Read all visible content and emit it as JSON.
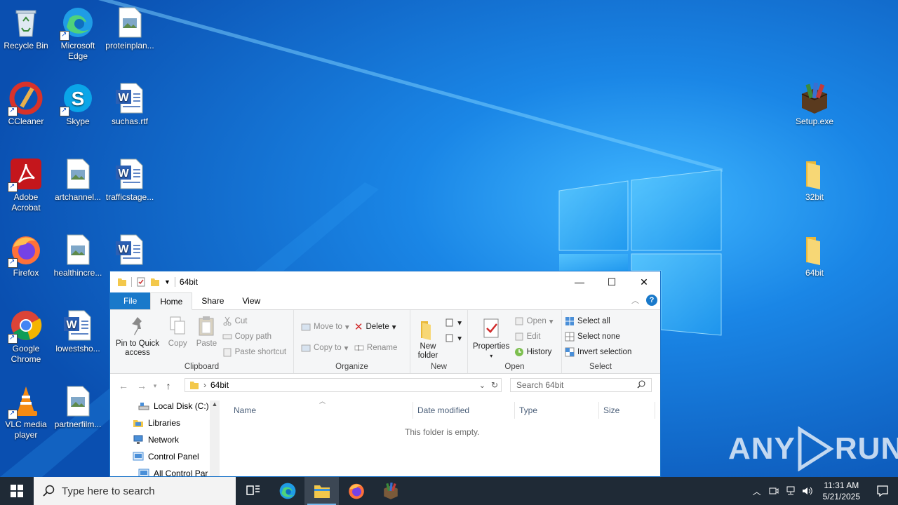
{
  "desktop": {
    "icons": [
      {
        "label": "Recycle Bin"
      },
      {
        "label": "Microsoft Edge"
      },
      {
        "label": "proteinplan..."
      },
      {
        "label": "CCleaner"
      },
      {
        "label": "Skype"
      },
      {
        "label": "suchas.rtf"
      },
      {
        "label": "Adobe Acrobat"
      },
      {
        "label": "artchannel..."
      },
      {
        "label": "trafficstage..."
      },
      {
        "label": "Firefox"
      },
      {
        "label": "healthincre..."
      },
      {
        "label": ""
      },
      {
        "label": "Google Chrome"
      },
      {
        "label": "lowestsho..."
      },
      {
        "label": "VLC media player"
      },
      {
        "label": "partnerfilm..."
      },
      {
        "label": "Setup.exe"
      },
      {
        "label": "32bit"
      },
      {
        "label": "64bit"
      }
    ]
  },
  "explorer": {
    "title": "64bit",
    "tabs": {
      "file": "File",
      "home": "Home",
      "share": "Share",
      "view": "View"
    },
    "ribbon": {
      "clipboard": {
        "label": "Clipboard",
        "pin": "Pin to Quick access",
        "copy": "Copy",
        "paste": "Paste",
        "cut": "Cut",
        "copy_path": "Copy path",
        "paste_shortcut": "Paste shortcut"
      },
      "organize": {
        "label": "Organize",
        "move_to": "Move to",
        "copy_to": "Copy to",
        "delete": "Delete",
        "rename": "Rename"
      },
      "new": {
        "label": "New",
        "new_folder": "New folder"
      },
      "open": {
        "label": "Open",
        "properties": "Properties",
        "open": "Open",
        "edit": "Edit",
        "history": "History"
      },
      "select": {
        "label": "Select",
        "select_all": "Select all",
        "select_none": "Select none",
        "invert": "Invert selection"
      }
    },
    "address": {
      "path": "64bit",
      "search_placeholder": "Search 64bit"
    },
    "nav": [
      {
        "label": "Local Disk (C:)"
      },
      {
        "label": "Libraries"
      },
      {
        "label": "Network"
      },
      {
        "label": "Control Panel"
      },
      {
        "label": "All Control Par"
      }
    ],
    "columns": {
      "name": "Name",
      "date": "Date modified",
      "type": "Type",
      "size": "Size"
    },
    "empty_message": "This folder is empty."
  },
  "taskbar": {
    "search_placeholder": "Type here to search",
    "time": "11:31 AM",
    "date": "5/21/2025"
  },
  "watermark": {
    "left": "ANY",
    "right": "RUN"
  },
  "colors": {
    "accent": "#1979ca",
    "taskbar": "#1f2a36",
    "folder": "#f3c84b"
  }
}
